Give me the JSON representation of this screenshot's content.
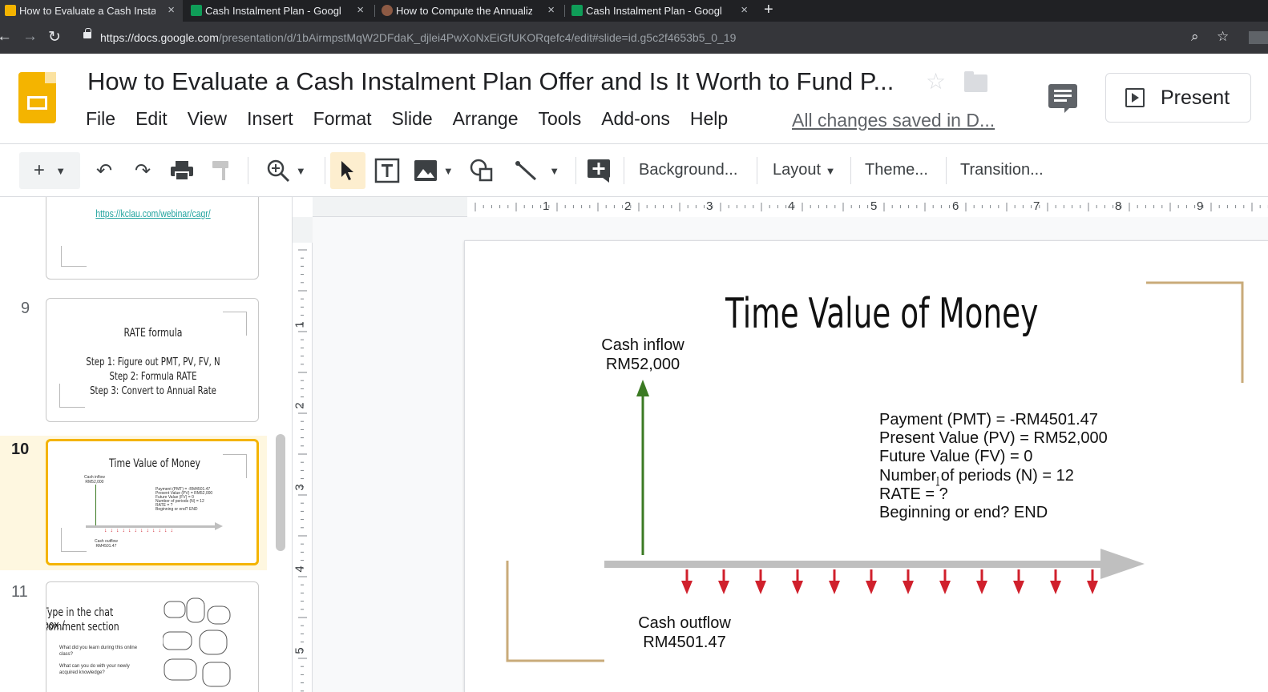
{
  "browser": {
    "tabs": [
      {
        "label": "How to Evaluate a Cash Instalm",
        "icon": "slides-icon"
      },
      {
        "label": "Cash Instalment Plan - Google",
        "icon": "sheets-icon"
      },
      {
        "label": "How to Compute the Annualize",
        "icon": "avatar-icon"
      },
      {
        "label": "Cash Instalment Plan - Google",
        "icon": "sheets-icon"
      }
    ],
    "url_host": "https://docs.google.com",
    "url_path": "/presentation/d/1bAirmpstMqW2DFdaK_djlei4PwXoNxEiGfUKORqefc4/edit#slide=id.g5c2f4653b5_0_19"
  },
  "doc": {
    "title": "How to Evaluate a Cash Instalment Plan Offer and Is It Worth to Fund P...",
    "menu": [
      "File",
      "Edit",
      "View",
      "Insert",
      "Format",
      "Slide",
      "Arrange",
      "Tools",
      "Add-ons",
      "Help"
    ],
    "saved_status": "All changes saved in D...",
    "present_label": "Present"
  },
  "toolbar": {
    "background": "Background...",
    "layout": "Layout",
    "theme": "Theme...",
    "transition": "Transition..."
  },
  "filmstrip": {
    "slide8": {
      "link": "https://kclau.com/webinar/cagr/"
    },
    "slide9": {
      "num": "9",
      "title": "RATE formula",
      "step1": "Step 1: Figure out PMT, PV, FV, N",
      "step2": "Step 2: Formula RATE",
      "step3": "Step 3: Convert to Annual Rate"
    },
    "slide10": {
      "num": "10",
      "title": "Time Value of Money"
    },
    "slide11": {
      "num": "11",
      "title1": "Type in the chat box /",
      "title2": "comment section",
      "q1a": "What did you learn during this online",
      "q1b": "class?",
      "q2a": "What can you do with your newly",
      "q2b": "acquired knowledge?"
    }
  },
  "ruler": {
    "top": [
      "1",
      "2",
      "3",
      "4",
      "5",
      "6",
      "7",
      "8",
      "9"
    ],
    "left": [
      "1",
      "2",
      "3",
      "4",
      "5"
    ]
  },
  "slide": {
    "title": "Time Value of Money",
    "inflow_label": "Cash inflow",
    "inflow_amount": "RM52,000",
    "outflow_label": "Cash outflow",
    "outflow_amount": "RM4501.47",
    "lines": [
      "Payment (PMT) = -RM4501.47",
      "Present Value (PV) = RM52,000",
      "Future Value (FV) = 0",
      "Number of periods (N) = 12",
      "RATE = ?",
      "Beginning or end?  END"
    ],
    "payments": 12,
    "colors": {
      "inflow": "#3b7a23",
      "outflow": "#d0202c",
      "timeline": "#bfbfbf",
      "frame": "#c9ab7a",
      "accent": "#f4b400"
    }
  }
}
